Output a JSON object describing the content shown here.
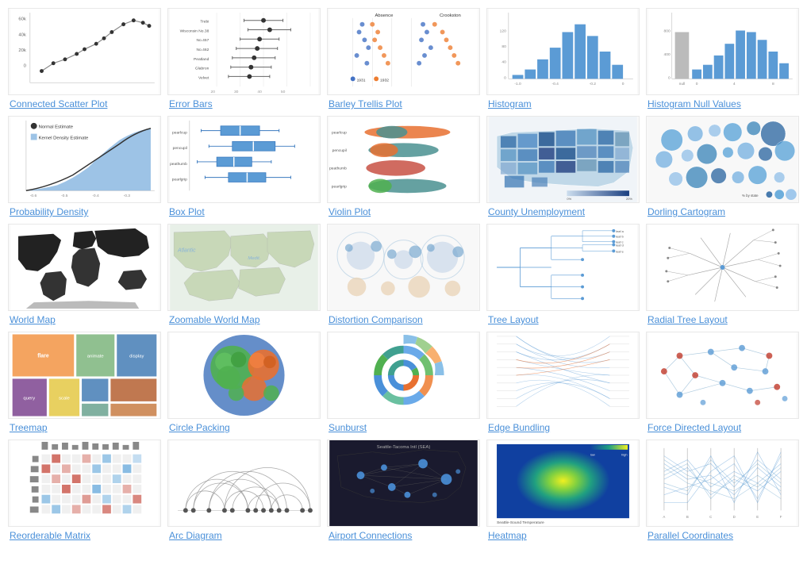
{
  "gallery": {
    "items": [
      {
        "id": "connected-scatter",
        "label": "Connected Scatter Plot"
      },
      {
        "id": "error-bars",
        "label": "Error Bars"
      },
      {
        "id": "barley-trellis",
        "label": "Barley Trellis Plot"
      },
      {
        "id": "histogram",
        "label": "Histogram"
      },
      {
        "id": "histogram-null",
        "label": "Histogram Null Values"
      },
      {
        "id": "probability-density",
        "label": "Probability Density"
      },
      {
        "id": "box-plot",
        "label": "Box Plot"
      },
      {
        "id": "violin-plot",
        "label": "Violin Plot"
      },
      {
        "id": "county-unemployment",
        "label": "County Unemployment"
      },
      {
        "id": "dorling-cartogram",
        "label": "Dorling Cartogram"
      },
      {
        "id": "world-map",
        "label": "World Map"
      },
      {
        "id": "zoomable-world-map",
        "label": "Zoomable World Map"
      },
      {
        "id": "distortion-comparison",
        "label": "Distortion Comparison"
      },
      {
        "id": "tree-layout",
        "label": "Tree Layout"
      },
      {
        "id": "radial-tree-layout",
        "label": "Radial Tree Layout"
      },
      {
        "id": "treemap",
        "label": "Treemap"
      },
      {
        "id": "circle-packing",
        "label": "Circle Packing"
      },
      {
        "id": "sunburst",
        "label": "Sunburst"
      },
      {
        "id": "edge-bundling",
        "label": "Edge Bundling"
      },
      {
        "id": "force-directed",
        "label": "Force Directed Layout"
      },
      {
        "id": "reorderable-matrix",
        "label": "Reorderable Matrix"
      },
      {
        "id": "arc-diagram",
        "label": "Arc Diagram"
      },
      {
        "id": "airport-connections",
        "label": "Airport Connections"
      },
      {
        "id": "heatmap",
        "label": "Heatmap"
      },
      {
        "id": "parallel-coordinates",
        "label": "Parallel Coordinates"
      }
    ]
  }
}
